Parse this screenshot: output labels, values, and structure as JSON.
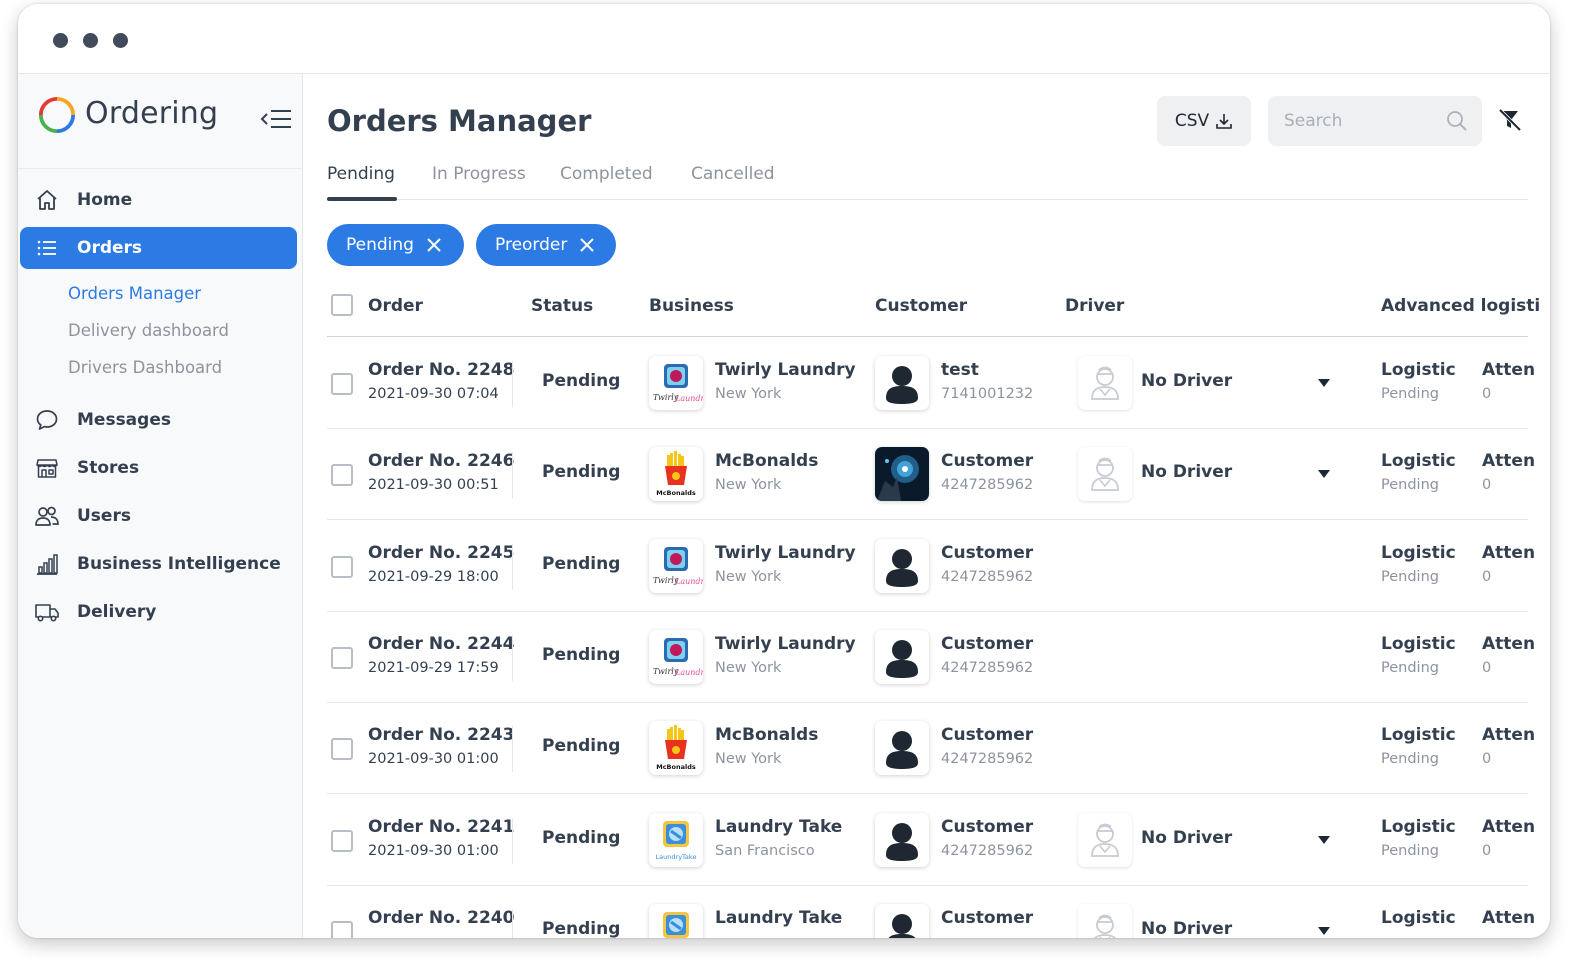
{
  "window": {
    "controls": [
      "dot",
      "dot",
      "dot"
    ]
  },
  "sidebar": {
    "logo_text": "Ordering",
    "nav": [
      {
        "label": "Home",
        "icon": "home-icon"
      },
      {
        "label": "Orders",
        "icon": "list-icon",
        "active": true
      },
      {
        "label": "Messages",
        "icon": "chat-bubble-icon"
      },
      {
        "label": "Stores",
        "icon": "store-icon"
      },
      {
        "label": "Users",
        "icon": "users-icon"
      },
      {
        "label": "Business Intelligence",
        "icon": "bar-chart-icon"
      },
      {
        "label": "Delivery",
        "icon": "truck-icon"
      }
    ],
    "orders_sub": [
      {
        "label": "Orders Manager",
        "active": true
      },
      {
        "label": "Delivery dashboard"
      },
      {
        "label": "Drivers Dashboard"
      }
    ]
  },
  "main": {
    "title": "Orders Manager",
    "csv_label": "CSV",
    "search_placeholder": "Search",
    "tabs": [
      "Pending",
      "In Progress",
      "Completed",
      "Cancelled"
    ],
    "active_tab": "Pending",
    "filters": [
      "Pending",
      "Preorder"
    ],
    "columns": [
      "Order",
      "Status",
      "Business",
      "Customer",
      "Driver",
      "Advanced logisti"
    ]
  },
  "orders": [
    {
      "order": "Order No. 2248",
      "date": "2021-09-30 07:04",
      "status": "Pending",
      "business": "Twirly Laundry",
      "business_logo": "twirly",
      "city": "New York",
      "customer": "test",
      "phone": "7141001232",
      "customer_photo": "avatar",
      "driver": "No Driver",
      "logistic": "Logistic",
      "logistic_status": "Pending",
      "atten": "Atten",
      "attempts": "0"
    },
    {
      "order": "Order No. 2246",
      "date": "2021-09-30 00:51",
      "status": "Pending",
      "business": "McBonalds",
      "business_logo": "mcbonalds",
      "city": "New York",
      "customer": "Customer",
      "phone": "4247285962",
      "customer_photo": "photo",
      "driver": "No Driver",
      "logistic": "Logistic",
      "logistic_status": "Pending",
      "atten": "Atten",
      "attempts": "0"
    },
    {
      "order": "Order No. 2245",
      "date": "2021-09-29 18:00",
      "status": "Pending",
      "business": "Twirly Laundry",
      "business_logo": "twirly",
      "city": "New York",
      "customer": "Customer",
      "phone": "4247285962",
      "customer_photo": "avatar",
      "driver": "",
      "logistic": "Logistic",
      "logistic_status": "Pending",
      "atten": "Atten",
      "attempts": "0"
    },
    {
      "order": "Order No. 2244",
      "date": "2021-09-29 17:59",
      "status": "Pending",
      "business": "Twirly Laundry",
      "business_logo": "twirly",
      "city": "New York",
      "customer": "Customer",
      "phone": "4247285962",
      "customer_photo": "avatar",
      "driver": "",
      "logistic": "Logistic",
      "logistic_status": "Pending",
      "atten": "Atten",
      "attempts": "0"
    },
    {
      "order": "Order No. 2243",
      "date": "2021-09-30 01:00",
      "status": "Pending",
      "business": "McBonalds",
      "business_logo": "mcbonalds",
      "city": "New York",
      "customer": "Customer",
      "phone": "4247285962",
      "customer_photo": "avatar",
      "driver": "",
      "logistic": "Logistic",
      "logistic_status": "Pending",
      "atten": "Atten",
      "attempts": "0"
    },
    {
      "order": "Order No. 2241",
      "date": "2021-09-30 01:00",
      "status": "Pending",
      "business": "Laundry Take",
      "business_logo": "laundrytake",
      "city": "San Francisco",
      "customer": "Customer",
      "phone": "4247285962",
      "customer_photo": "avatar",
      "driver": "No Driver",
      "logistic": "Logistic",
      "logistic_status": "Pending",
      "atten": "Atten",
      "attempts": "0"
    },
    {
      "order": "Order No. 2240",
      "date": "",
      "status": "Pending",
      "business": "Laundry Take",
      "business_logo": "laundrytake",
      "city": "",
      "customer": "Customer",
      "phone": "",
      "customer_photo": "avatar",
      "driver": "No Driver",
      "logistic": "Logistic",
      "logistic_status": "",
      "atten": "Atten",
      "attempts": ""
    }
  ],
  "colors": {
    "accent": "#2c7be5",
    "text": "#344050",
    "muted": "#8d949e",
    "surface": "#eef0f2",
    "dark_dot": "#414b5c"
  }
}
